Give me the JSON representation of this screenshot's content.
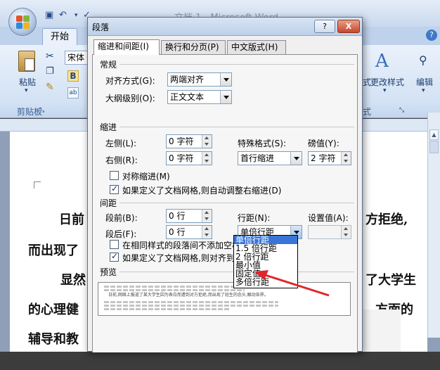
{
  "window": {
    "doc_title": "文档 1 - Microsoft Word",
    "ribbon_tab_home": "开始",
    "help_glyph": "?"
  },
  "ribbon": {
    "paste_label": "粘贴",
    "clipboard_group": "剪贴板",
    "font_name": "宋体",
    "bold_glyph": "B",
    "styles_label": "更改样式",
    "styles_partial": "式",
    "styles_group": "式",
    "edit_label": "编辑"
  },
  "document": {
    "lines": [
      {
        "left": "日前",
        "right": "方拒绝,"
      },
      {
        "left": "而出现了",
        "right": ""
      },
      {
        "left": "显然",
        "right": "了大学生"
      },
      {
        "left": "的心理健",
        "right": "方面的"
      },
      {
        "left": "辅导和教",
        "right": ""
      }
    ]
  },
  "dialog": {
    "title": "段落",
    "help_button": "?",
    "close_button": "X",
    "tabs": [
      {
        "label": "缩进和间距(I)",
        "active": true
      },
      {
        "label": "换行和分页(P)",
        "active": false
      },
      {
        "label": "中文版式(H)",
        "active": false
      }
    ],
    "general": {
      "heading": "常规",
      "alignment_label": "对齐方式(G):",
      "alignment_value": "两端对齐",
      "outline_label": "大纲级别(O):",
      "outline_value": "正文文本"
    },
    "indent": {
      "heading": "缩进",
      "left_label": "左侧(L):",
      "left_value": "0 字符",
      "right_label": "右侧(R):",
      "right_value": "0 字符",
      "special_label": "特殊格式(S):",
      "special_value": "首行缩进",
      "by_label": "磅值(Y):",
      "by_value": "2 字符",
      "mirror_label": "对称缩进(M)",
      "mirror_checked": false,
      "auto_adjust_label": "如果定义了文档网格,则自动调整右缩进(D)",
      "auto_adjust_checked": true
    },
    "spacing": {
      "heading": "间距",
      "before_label": "段前(B):",
      "before_value": "0 行",
      "after_label": "段后(F):",
      "after_value": "0 行",
      "line_label": "行距(N):",
      "line_value": "单倍行距",
      "at_label": "设置值(A):",
      "at_value": "",
      "no_space_label": "在相同样式的段落间不添加空格",
      "no_space_checked": false,
      "snap_label": "如果定义了文档网格,则对齐到",
      "snap_checked": true,
      "line_options": [
        "单倍行距",
        "1.5 倍行距",
        "2 倍行距",
        "最小值",
        "固定值",
        "多倍行距"
      ],
      "selected_option_index": 0
    },
    "preview": {
      "heading": "预览",
      "sample_text": "日前,网络上报道了某大学生因为表白而遭到对方拒绝,而出现了轻生的念头,触动各界。"
    }
  },
  "colors": {
    "selection": "#3875d7",
    "annotation_arrow": "#e0262a"
  }
}
